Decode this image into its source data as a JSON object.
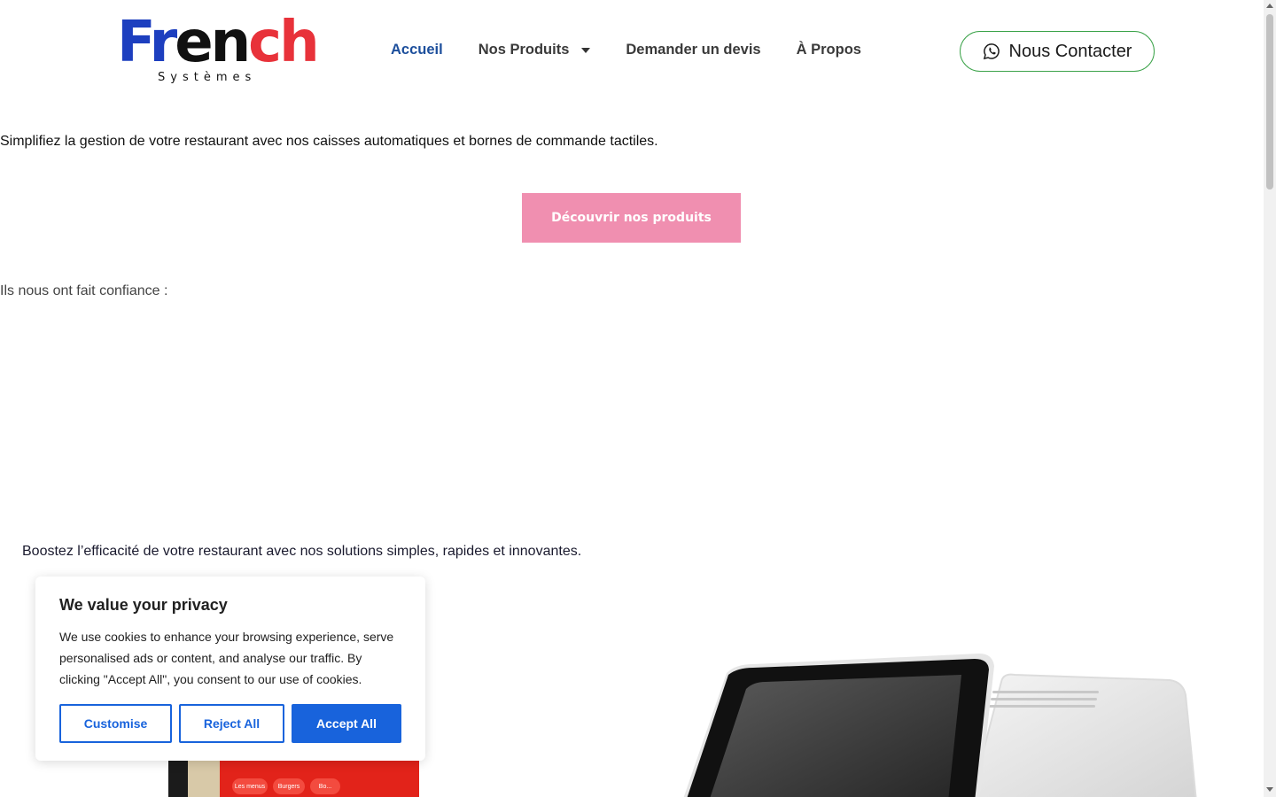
{
  "header": {
    "logo": {
      "word_part1": "Fr",
      "word_part2": "en",
      "word_part3": "ch",
      "sub": "Systèmes"
    },
    "nav": [
      {
        "label": "Accueil"
      },
      {
        "label": "Nos Produits"
      },
      {
        "label": "Demander un devis"
      },
      {
        "label": "À Propos"
      }
    ],
    "contact_label": "Nous Contacter"
  },
  "main": {
    "intro": "Simplifiez la gestion de votre restaurant avec nos caisses automatiques et bornes de commande tactiles.",
    "discover_label": "Découvrir nos produits",
    "trust_label": "Ils nous ont fait confiance :",
    "boost": "Boostez l’efficacité de votre restaurant avec nos solutions simples, rapides et innovantes."
  },
  "kiosk": {
    "pills": [
      "Les menus",
      "Burgers",
      "Bo..."
    ]
  },
  "cookie": {
    "title": "We value your privacy",
    "text": "We use cookies to enhance your browsing experience, serve personalised ads or content, and analyse our traffic. By clicking \"Accept All\", you consent to our use of cookies.",
    "customise": "Customise",
    "reject": "Reject All",
    "accept": "Accept All"
  },
  "colors": {
    "accent_blue": "#1863dc",
    "nav_active": "#1d4f9c",
    "discover_button": "#f08fb0",
    "contact_border": "#3ca34a"
  }
}
